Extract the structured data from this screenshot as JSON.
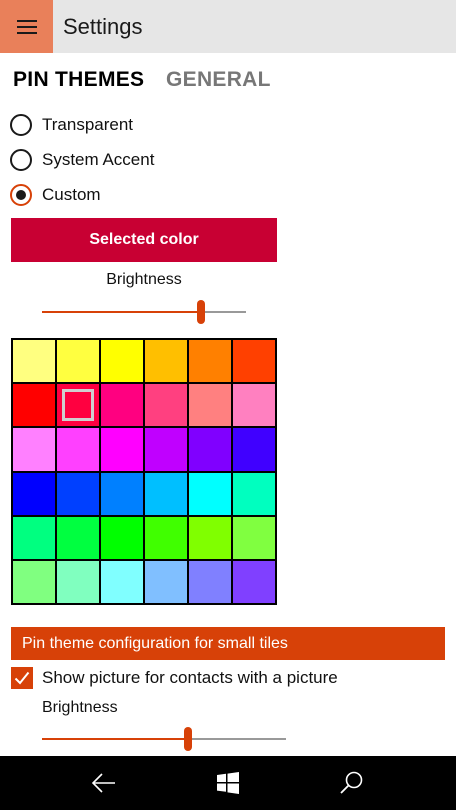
{
  "header": {
    "title": "Settings",
    "menu_icon": "hamburger-icon"
  },
  "tabs": [
    {
      "label": "PIN THEMES",
      "active": true
    },
    {
      "label": "GENERAL",
      "active": false
    }
  ],
  "theme_options": [
    {
      "label": "Transparent",
      "checked": false
    },
    {
      "label": "System Accent",
      "checked": false
    },
    {
      "label": "Custom",
      "checked": true
    }
  ],
  "selected_color": {
    "label": "Selected color",
    "color": "#c80033"
  },
  "brightness_main": {
    "label": "Brightness",
    "value": 0.78
  },
  "palette": {
    "selected_index": 7,
    "colors": [
      "#ffff80",
      "#ffff40",
      "#ffff00",
      "#ffbf00",
      "#ff8000",
      "#ff4000",
      "#ff0000",
      "#ff0040",
      "#ff0080",
      "#ff4080",
      "#ff8080",
      "#ff80c0",
      "#ff80ff",
      "#ff40ff",
      "#ff00ff",
      "#c000ff",
      "#8000ff",
      "#4000ff",
      "#0000ff",
      "#0040ff",
      "#0080ff",
      "#00bfff",
      "#00ffff",
      "#00ffbf",
      "#00ff80",
      "#00ff40",
      "#00ff00",
      "#40ff00",
      "#80ff00",
      "#80ff40",
      "#80ff80",
      "#80ffbf",
      "#80ffff",
      "#80bfff",
      "#8080ff",
      "#8040ff"
    ]
  },
  "small_tiles": {
    "header": "Pin theme configuration for small tiles",
    "show_picture_label": "Show picture for contacts with a picture",
    "show_picture_checked": true,
    "brightness_label": "Brightness",
    "brightness_value": 0.6
  },
  "navbar": {
    "back_icon": "back-arrow-icon",
    "home_icon": "windows-logo-icon",
    "search_icon": "search-icon"
  },
  "accent_color": "#d74108"
}
